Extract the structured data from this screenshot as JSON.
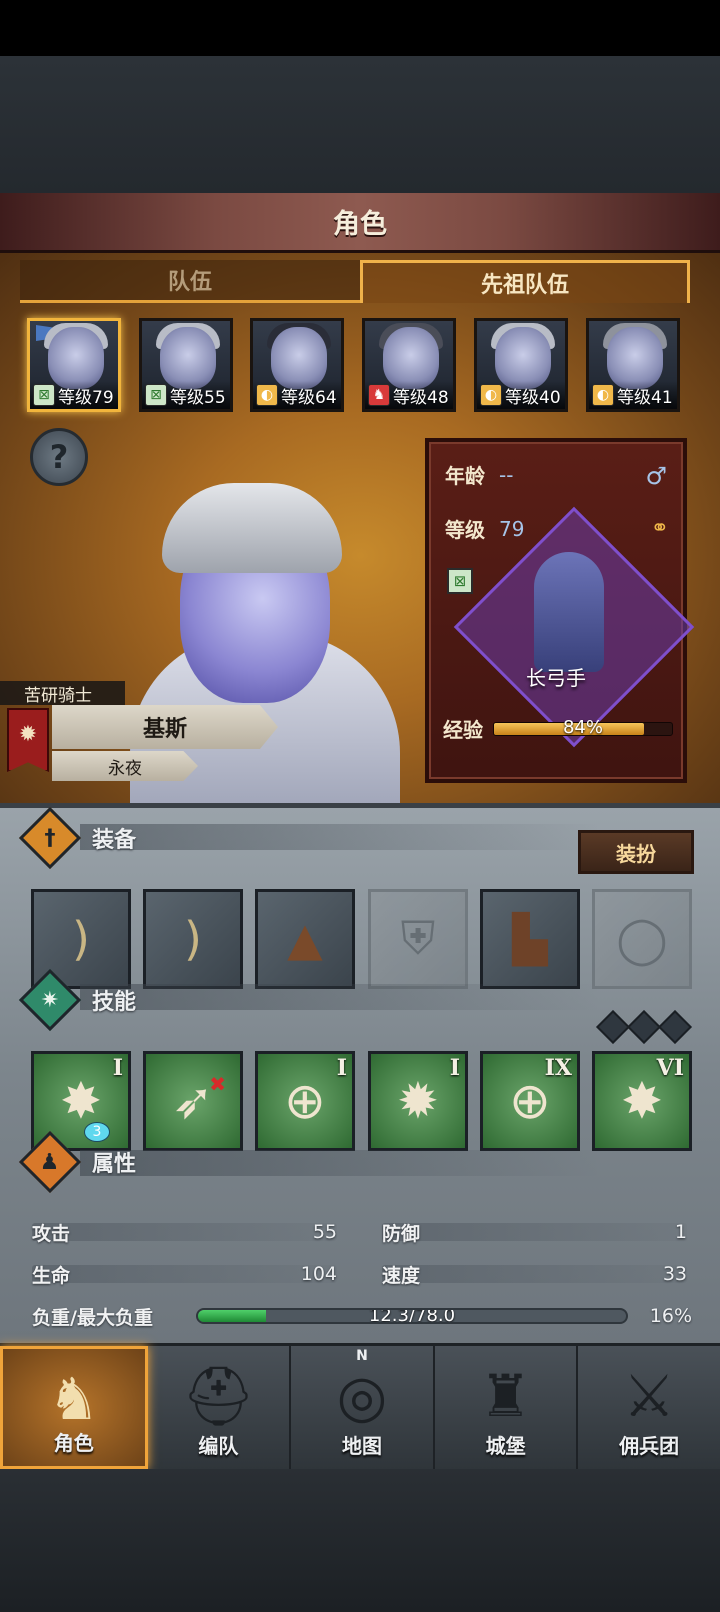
{
  "header": {
    "title": "角色"
  },
  "tabs": [
    {
      "label": "队伍",
      "active": false
    },
    {
      "label": "先祖队伍",
      "active": true
    }
  ],
  "party": [
    {
      "level": "等级79",
      "class_icon": "bow-icon",
      "selected": true
    },
    {
      "level": "等级55",
      "class_icon": "bow-icon",
      "selected": false
    },
    {
      "level": "等级64",
      "class_icon": "shield-icon",
      "selected": false
    },
    {
      "level": "等级48",
      "class_icon": "beast-icon",
      "selected": false
    },
    {
      "level": "等级40",
      "class_icon": "shield-icon",
      "selected": false
    },
    {
      "level": "等级41",
      "class_icon": "shield-icon",
      "selected": false
    }
  ],
  "help": {
    "icon": "?"
  },
  "hero": {
    "title": "苦研骑士",
    "name": "基斯",
    "subtitle": "永夜",
    "age_label": "年龄",
    "age_value": "--",
    "level_label": "等级",
    "level_value": "79",
    "class_name": "长弓手",
    "exp_label": "经验",
    "exp_text": "84%",
    "exp_percent": 84,
    "gender_icon": "♂",
    "ring_icon": "ring-icon"
  },
  "equipment": {
    "label": "装备",
    "dress_button": "装扮",
    "slots": [
      {
        "icon": "longbow-icon",
        "empty": false
      },
      {
        "icon": "longbow-icon",
        "empty": false
      },
      {
        "icon": "hood-icon",
        "empty": false
      },
      {
        "icon": "armor-icon",
        "empty": true
      },
      {
        "icon": "boots-icon",
        "empty": false
      },
      {
        "icon": "ring-icon",
        "empty": true
      }
    ]
  },
  "skills": {
    "label": "技能",
    "items": [
      {
        "icon": "burst-sword-icon",
        "rank": "I",
        "badge": "3"
      },
      {
        "icon": "bow-horse-icon",
        "rank": "",
        "badge": ""
      },
      {
        "icon": "crosshair-diamond-icon",
        "rank": "I",
        "badge": ""
      },
      {
        "icon": "star-burst-icon",
        "rank": "I",
        "badge": ""
      },
      {
        "icon": "crosshair-icon",
        "rank": "IX",
        "badge": ""
      },
      {
        "icon": "burst-icon",
        "rank": "VI",
        "badge": ""
      }
    ]
  },
  "attributes": {
    "label": "属性",
    "attack_label": "攻击",
    "attack_value": "55",
    "defense_label": "防御",
    "defense_value": "1",
    "hp_label": "生命",
    "hp_value": "104",
    "speed_label": "速度",
    "speed_value": "33",
    "load_label": "负重/最大负重",
    "load_text": "12.3/78.0",
    "load_percent": "16%",
    "load_fraction": 0.16
  },
  "nav": [
    {
      "label": "角色",
      "icon": "knight-icon",
      "active": true
    },
    {
      "label": "编队",
      "icon": "helmet-icon",
      "active": false
    },
    {
      "label": "地图",
      "icon": "compass-map-icon",
      "active": false,
      "compass_letter": "N"
    },
    {
      "label": "城堡",
      "icon": "castle-icon",
      "active": false
    },
    {
      "label": "佣兵团",
      "icon": "mercenary-icon",
      "active": false
    }
  ],
  "colors": {
    "accent": "#f0a43a",
    "panel": "#5a1e16",
    "skill_bg": "#3f7a42"
  }
}
